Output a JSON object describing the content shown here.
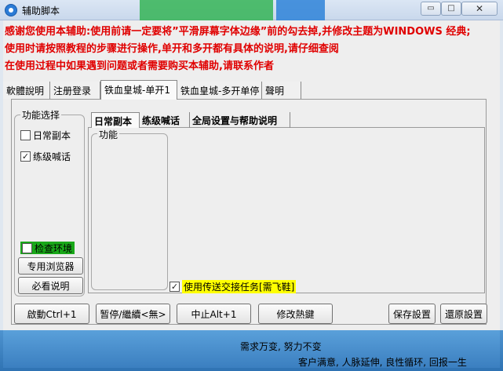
{
  "window": {
    "title": "辅助脚本",
    "min_glyph": "▭",
    "max_glyph": "□",
    "close_glyph": "✕"
  },
  "notice": {
    "line1": "感谢您使用本辅助:使用前请一定要将”平滑屏幕字体边缘”前的勾去掉,并修改主题为WINDOWS 经典;",
    "line2": "使用时请按照教程的步骤进行操作,单开和多开都有具体的说明,请仔细查阅",
    "line3": "在使用过程中如果遇到问题或者需要购买本辅助,请联系作者"
  },
  "main_tabs": [
    {
      "label": "軟體說明"
    },
    {
      "label": "注册登录"
    },
    {
      "label": "铁血皇城-单开1"
    },
    {
      "label": "铁血皇城-多开单停"
    },
    {
      "label": "聲明"
    }
  ],
  "side": {
    "group_title": "功能选择",
    "daily": {
      "label": "日常副本",
      "checked": false
    },
    "shout": {
      "label": "练级喊话",
      "checked": true
    },
    "env": {
      "label": "检查环境",
      "checked": false
    },
    "browser_button": "专用浏览器",
    "must_read_button": "必看说明"
  },
  "inner_tabs": [
    {
      "label": "日常副本"
    },
    {
      "label": "练级喊话"
    },
    {
      "label": "全局设置与帮助说明"
    }
  ],
  "inner": {
    "func_title": "功能",
    "teleport": {
      "label": "使用传送交接任务[需飞鞋]",
      "checked": true
    }
  },
  "bottom_buttons": {
    "start": "啟動Ctrl+1",
    "pause": "暂停/繼續<無>",
    "stop": "中止Alt+1",
    "hotkey": "修改熱鍵",
    "save": "保存設置",
    "restore": "還原設置"
  },
  "footer": {
    "slogan1": "需求万变, 努力不变",
    "slogan2": "客户满意, 人脉延伸, 良性循环, 回报一生"
  },
  "colors": {
    "notice_red": "#e00000",
    "env_green": "#19a819",
    "highlight_yellow": "#ffff00",
    "footer_blue": "#3b7fc0"
  }
}
